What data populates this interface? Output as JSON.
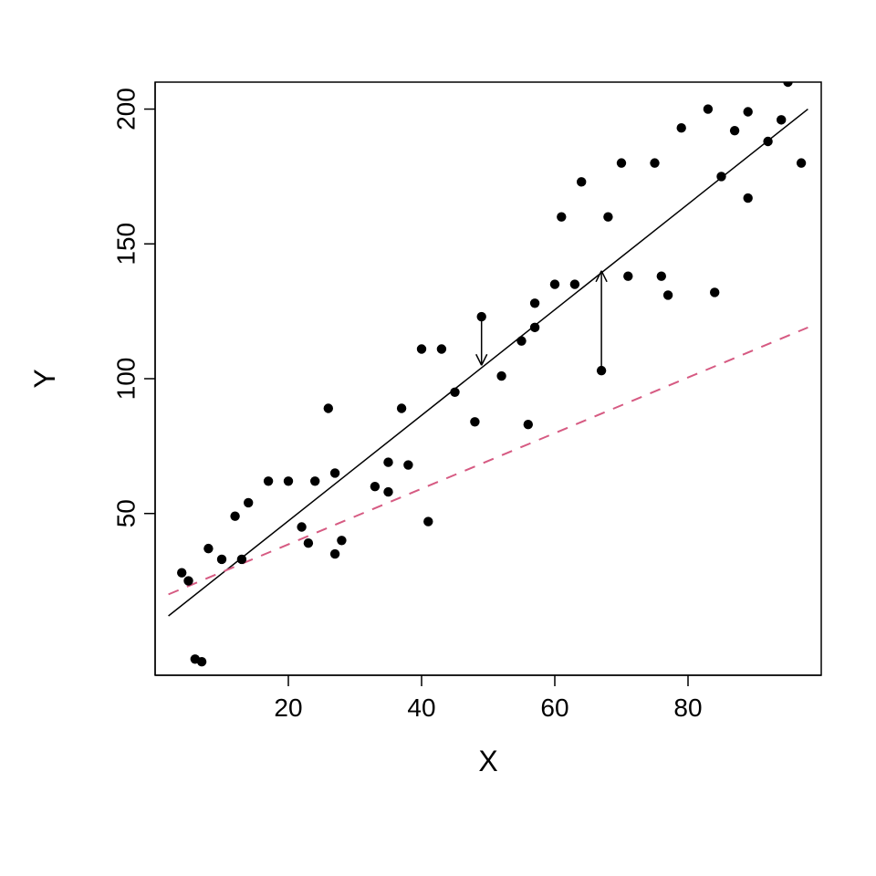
{
  "chart_data": {
    "type": "scatter",
    "xlabel": "X",
    "ylabel": "Y",
    "xlim": [
      0,
      100
    ],
    "ylim": [
      -10,
      210
    ],
    "x_ticks": [
      20,
      40,
      60,
      80
    ],
    "y_ticks": [
      50,
      100,
      150,
      200
    ],
    "points": [
      {
        "x": 4,
        "y": 28
      },
      {
        "x": 5,
        "y": 25
      },
      {
        "x": 6,
        "y": -4
      },
      {
        "x": 7,
        "y": -5
      },
      {
        "x": 8,
        "y": 37
      },
      {
        "x": 10,
        "y": 33
      },
      {
        "x": 12,
        "y": 49
      },
      {
        "x": 13,
        "y": 33
      },
      {
        "x": 14,
        "y": 54
      },
      {
        "x": 17,
        "y": 62
      },
      {
        "x": 20,
        "y": 62
      },
      {
        "x": 22,
        "y": 45
      },
      {
        "x": 23,
        "y": 39
      },
      {
        "x": 24,
        "y": 62
      },
      {
        "x": 26,
        "y": 89
      },
      {
        "x": 27,
        "y": 65
      },
      {
        "x": 27,
        "y": 35
      },
      {
        "x": 28,
        "y": 40
      },
      {
        "x": 33,
        "y": 60
      },
      {
        "x": 35,
        "y": 58
      },
      {
        "x": 35,
        "y": 69
      },
      {
        "x": 37,
        "y": 89
      },
      {
        "x": 38,
        "y": 68
      },
      {
        "x": 40,
        "y": 111
      },
      {
        "x": 41,
        "y": 47
      },
      {
        "x": 43,
        "y": 111
      },
      {
        "x": 45,
        "y": 95
      },
      {
        "x": 48,
        "y": 84
      },
      {
        "x": 49,
        "y": 123
      },
      {
        "x": 52,
        "y": 101
      },
      {
        "x": 55,
        "y": 114
      },
      {
        "x": 56,
        "y": 83
      },
      {
        "x": 57,
        "y": 119
      },
      {
        "x": 57,
        "y": 128
      },
      {
        "x": 60,
        "y": 135
      },
      {
        "x": 61,
        "y": 160
      },
      {
        "x": 63,
        "y": 135
      },
      {
        "x": 64,
        "y": 173
      },
      {
        "x": 67,
        "y": 103
      },
      {
        "x": 68,
        "y": 160
      },
      {
        "x": 70,
        "y": 180
      },
      {
        "x": 71,
        "y": 138
      },
      {
        "x": 75,
        "y": 180
      },
      {
        "x": 76,
        "y": 138
      },
      {
        "x": 77,
        "y": 131
      },
      {
        "x": 79,
        "y": 193
      },
      {
        "x": 83,
        "y": 200
      },
      {
        "x": 84,
        "y": 132
      },
      {
        "x": 85,
        "y": 175
      },
      {
        "x": 87,
        "y": 192
      },
      {
        "x": 89,
        "y": 167
      },
      {
        "x": 89,
        "y": 199
      },
      {
        "x": 92,
        "y": 188
      },
      {
        "x": 94,
        "y": 196
      },
      {
        "x": 95,
        "y": 210
      },
      {
        "x": 97,
        "y": 180
      }
    ],
    "lines": [
      {
        "name": "fit",
        "color": "#000000",
        "dash": false,
        "x1": 2,
        "y1": 12,
        "x2": 98,
        "y2": 200
      },
      {
        "name": "dash",
        "color": "#d65a82",
        "dash": true,
        "x1": 2,
        "y1": 20,
        "x2": 98,
        "y2": 119
      }
    ],
    "arrows": [
      {
        "x": 49,
        "y_from": 123,
        "y_to": 105
      },
      {
        "x": 67,
        "y_from": 103,
        "y_to": 140
      }
    ]
  }
}
